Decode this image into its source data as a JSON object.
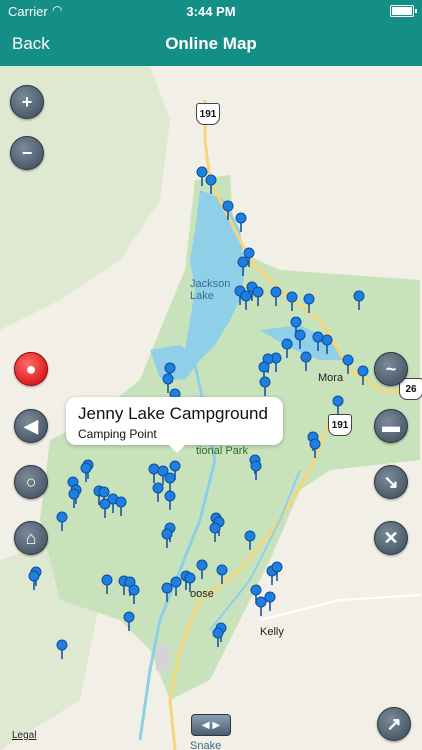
{
  "status": {
    "carrier": "Carrier",
    "time": "3:44 PM"
  },
  "nav": {
    "back": "Back",
    "title": "Online Map"
  },
  "callout": {
    "title": "Jenny Lake Campground",
    "subtitle": "Camping Point"
  },
  "labels": {
    "lake": "Jackson\nLake",
    "park": "tional Park",
    "moran": "Mora",
    "moose": "oose",
    "kelly": "Kelly",
    "snake": "Snake",
    "legal": "Legal"
  },
  "shields": {
    "us191_top": "191",
    "us191_mid": "191",
    "us26": "26"
  },
  "colors": {
    "header": "#148f86",
    "pin": "#1f7fe0",
    "lake": "#8fcfe8",
    "park": "#c8e2bc"
  },
  "controls": [
    "zoom-in",
    "zoom-out",
    "pin",
    "locate",
    "search",
    "home",
    "track",
    "car",
    "hiking",
    "tools",
    "compass"
  ]
}
